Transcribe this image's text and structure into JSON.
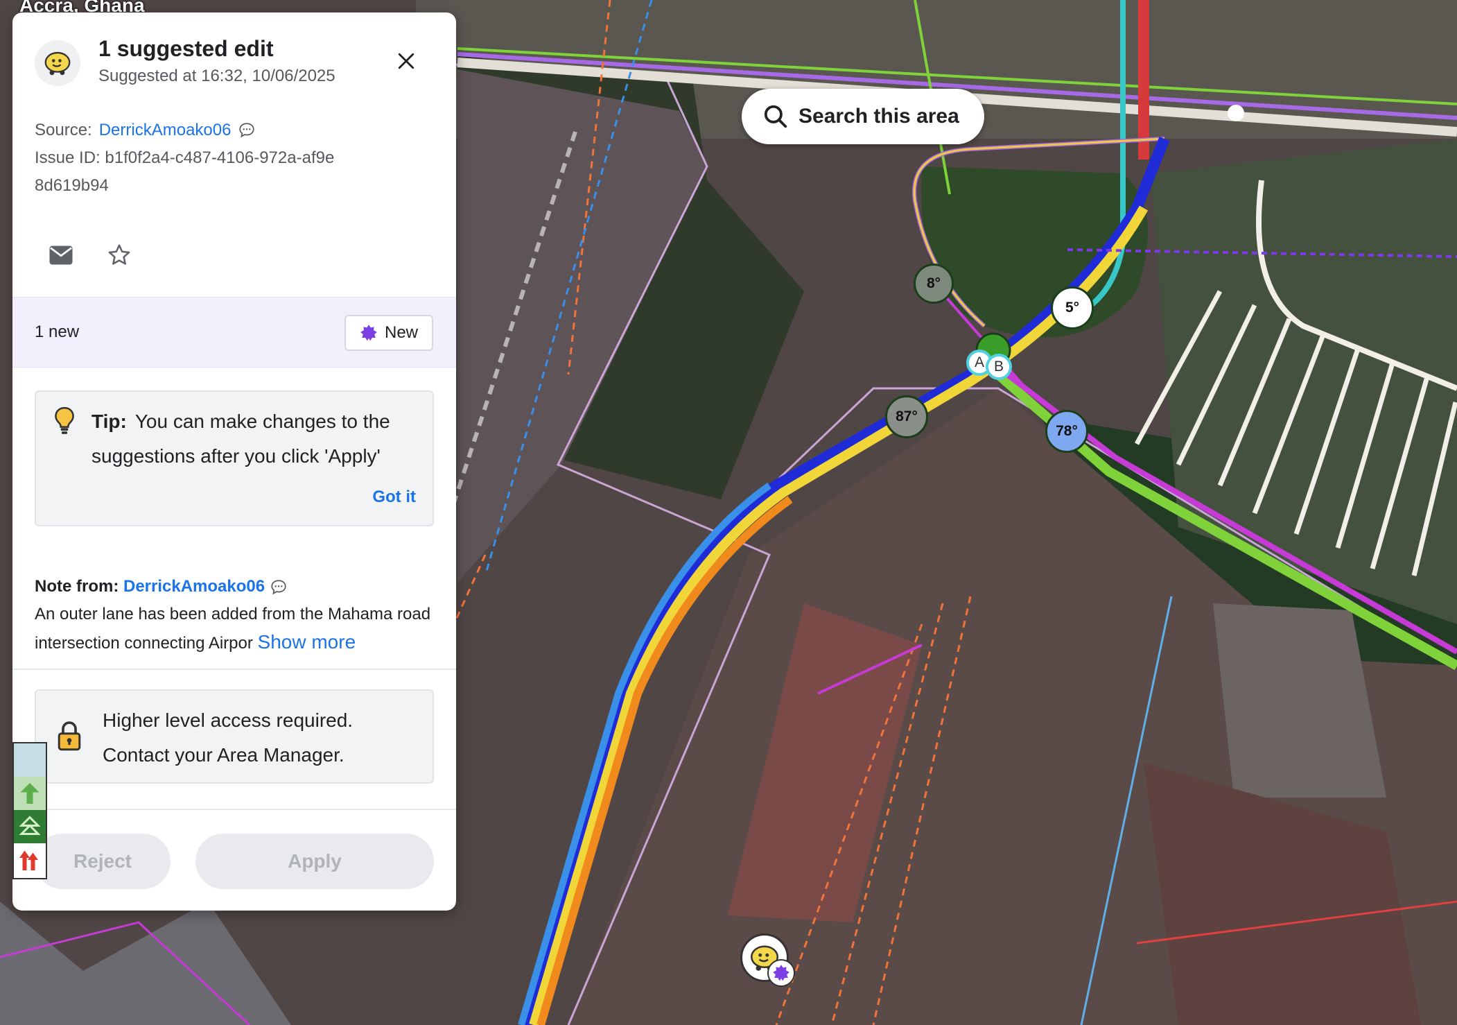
{
  "map": {
    "city_label": "Accra, Ghana",
    "search_button": "Search this area",
    "angles": [
      "8°",
      "5°",
      "87°",
      "78°"
    ],
    "nodes": [
      "A",
      "B"
    ]
  },
  "panel": {
    "title": "1 suggested edit",
    "subtitle": "Suggested at 16:32, 10/06/2025",
    "source_label": "Source:",
    "source_user": "DerrickAmoako06",
    "issue_label": "Issue ID:",
    "issue_id": "b1f0f2a4-c487-4106-972a-af9e8d619b94",
    "new_count": "1 new",
    "new_button": "New",
    "tip_label": "Tip:",
    "tip_text": "You can make changes to the suggestions after you click 'Apply'",
    "tip_action": "Got it",
    "note_label": "Note from:",
    "note_user": "DerrickAmoako06",
    "note_text": "An outer lane has been added from the Mahama road intersection connecting Airpor",
    "note_more": "Show more",
    "access_line1": "Higher level access required.",
    "access_line2": "Contact your Area Manager.",
    "reject": "Reject",
    "apply": "Apply"
  },
  "colors": {
    "accent": "#1a73e8",
    "new_badge": "#7b3fe4"
  }
}
